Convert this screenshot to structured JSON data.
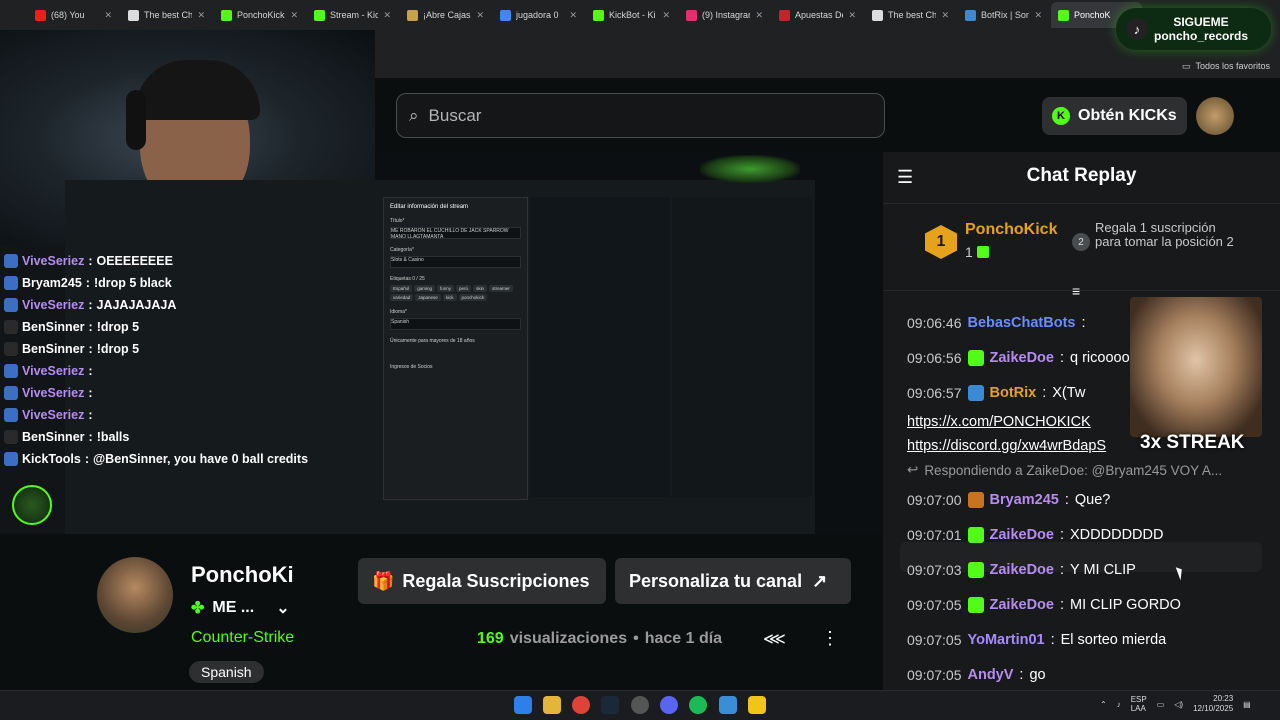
{
  "browser": {
    "tabs": [
      {
        "label": "(68) You",
        "color": "#e62117"
      },
      {
        "label": "The best Ch",
        "color": "#dddddd"
      },
      {
        "label": "PonchoKick",
        "color": "#53fc18"
      },
      {
        "label": "Stream - Kick",
        "color": "#53fc18"
      },
      {
        "label": "¡Abre Cajas",
        "color": "#c8a14a"
      },
      {
        "label": "jugadora 0",
        "color": "#4285f4"
      },
      {
        "label": "KickBot - Ki",
        "color": "#53fc18"
      },
      {
        "label": "(9) Instagran",
        "color": "#e1306c"
      },
      {
        "label": "Apuestas De",
        "color": "#c4232a"
      },
      {
        "label": "The best Ch",
        "color": "#dddddd"
      },
      {
        "label": "BotRix | Son",
        "color": "#3c8ad6"
      },
      {
        "label": "PonchoK",
        "color": "#53fc18"
      }
    ],
    "bookmarks_label": "Todos los favoritos"
  },
  "promo": {
    "line1": "SIGUEME",
    "line2": "poncho_records"
  },
  "header": {
    "search_placeholder": "Buscar",
    "kicks_button": "Obtén KICKs"
  },
  "stream_modal": {
    "title": "Editar información del stream",
    "field_title": "Título*",
    "field_title_value": "ME ROBARON EL CUCHILLO DE JACK SPARROW MANO LLAGTAMANTA",
    "field_category": "Categoría*",
    "category_value": "Slots & Casino",
    "field_tags": "Etiquetas",
    "tags_count": "0 / 25",
    "tags": [
      "Español",
      "gaming",
      "funny",
      "perú",
      "skin",
      "streamer",
      "variedad",
      "Japanese",
      "kick",
      "ponchokick"
    ],
    "field_language": "Idioma*",
    "language_value": "Spanish",
    "adult": "Únicamente para mayores de 18 años",
    "sub_income": "Ingresos de Socios"
  },
  "overlay_chat": [
    {
      "name": "ViveSeriez",
      "msg": "OEEEEEEEE",
      "style": "v"
    },
    {
      "name": "Bryam245",
      "msg": "!drop 5 black",
      "style": "w"
    },
    {
      "name": "ViveSeriez",
      "msg": "JAJAJAJAJA",
      "style": "v"
    },
    {
      "name": "BenSinner",
      "msg": "!drop 5",
      "style": "g"
    },
    {
      "name": "BenSinner",
      "msg": "!drop 5",
      "style": "g"
    },
    {
      "name": "ViveSeriez",
      "msg": "",
      "style": "v"
    },
    {
      "name": "ViveSeriez",
      "msg": "",
      "style": "v"
    },
    {
      "name": "ViveSeriez",
      "msg": "",
      "style": "v"
    },
    {
      "name": "BenSinner",
      "msg": "!balls",
      "style": "g"
    },
    {
      "name": "KickTools",
      "msg": "@BenSinner, you have 0 ball credits",
      "style": "w"
    }
  ],
  "chat": {
    "title": "Chat Replay",
    "top_gifter": {
      "rank": "1",
      "name": "PonchoKick",
      "count": "1"
    },
    "second": {
      "rank": "2",
      "text": "Regala 1 suscripción para tomar la posición 2"
    },
    "messages": [
      {
        "time": "09:06:46",
        "name": "BebasChatBots",
        "msg": "",
        "color": "#6a8cff",
        "badge": ""
      },
      {
        "time": "09:06:56",
        "name": "ZaikeDoe",
        "msg": "q ricoooo",
        "color": "#b58cf0",
        "badge": "bg-green"
      },
      {
        "time": "09:06:57",
        "name": "BotRix",
        "msg": "X(Tw",
        "color": "#e5a21a",
        "badge": "bg-blue"
      }
    ],
    "links": [
      "https://x.com/PONCHOKICK",
      "https://discord.gg/xw4wrBdapS"
    ],
    "reply": "Respondiendo a ZaikeDoe: @Bryam245 VOY A...",
    "messages2": [
      {
        "time": "09:07:00",
        "name": "Bryam245",
        "msg": "Que?",
        "color": "#b58cf0",
        "badge": "bg-orange"
      },
      {
        "time": "09:07:01",
        "name": "ZaikeDoe",
        "msg": "XDDDDDDDD",
        "color": "#b58cf0",
        "badge": "bg-green"
      },
      {
        "time": "09:07:03",
        "name": "ZaikeDoe",
        "msg": "Y MI CLIP",
        "color": "#b58cf0",
        "badge": "bg-green"
      },
      {
        "time": "09:07:05",
        "name": "ZaikeDoe",
        "msg": "MI CLIP GORDO",
        "color": "#b58cf0",
        "badge": "bg-green"
      },
      {
        "time": "09:07:05",
        "name": "YoMartin01",
        "msg": "El sorteo mierda",
        "color": "#a78bff",
        "badge": ""
      },
      {
        "time": "09:07:05",
        "name": "AndyV",
        "msg": "go",
        "color": "#b58cf0",
        "badge": ""
      }
    ],
    "streak": "3x STREAK"
  },
  "channel": {
    "name": "PonchoKi",
    "title": "ME ...",
    "category": "Counter-Strike",
    "language": "Spanish",
    "gift_button": "Regala Suscripciones",
    "customize_button": "Personaliza tu canal",
    "views": "169",
    "views_label": "visualizaciones",
    "ago": "hace 1 día"
  },
  "taskbar": {
    "lang": "ESP\nLAA",
    "time": "20:23",
    "date": "12/10/2025"
  }
}
